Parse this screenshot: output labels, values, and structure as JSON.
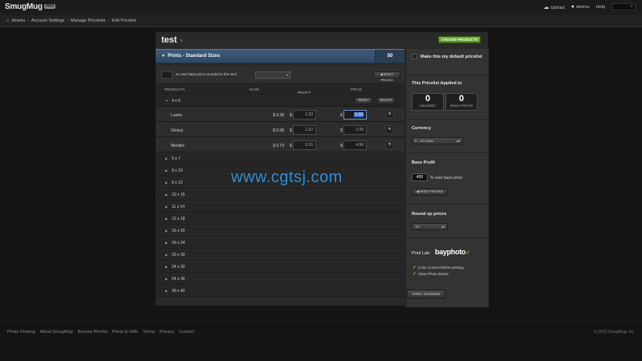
{
  "app": {
    "logo": "SmugMug",
    "logo_badge": "PRO"
  },
  "topbar": {
    "upload": "Upload",
    "user": "dmenu",
    "help": "Help",
    "search_icon": "search-icon"
  },
  "breadcrumb": [
    "dmenu",
    "Account Settings",
    "Manage Pricelists",
    "Edit Pricelist"
  ],
  "pricelist": {
    "title": "test",
    "choose_products": "CHOOSE PRODUCTS",
    "section_label": "Prints - Standard Sizes",
    "section_count": "50",
    "option_label": "% over base price rounded to the next",
    "option_select": "",
    "reset_pricing": "RESET PRICING",
    "columns": {
      "products": "PRODUCTS",
      "base": "BASE",
      "profit": "PROFIT",
      "price": "PRICE"
    },
    "group": {
      "name": "4 x 6",
      "reset": "RESET",
      "delete": "DELETE"
    },
    "items": [
      {
        "name": "Lustre",
        "base": "$ 0.38",
        "cur1": "$",
        "profit": "1.03",
        "cur2": "$",
        "price": "5.00"
      },
      {
        "name": "Glossy",
        "base": "$ 0.38",
        "cur1": "$",
        "profit": "1.52",
        "cur2": "$",
        "price": "2.99"
      },
      {
        "name": "Metallic",
        "base": "$ 0.79",
        "cur1": "$",
        "profit": "3.16",
        "cur2": "$",
        "price": "4.99"
      }
    ],
    "sizes": [
      "5 x 7",
      "8 x 10",
      "8 x 12",
      "10 x 15",
      "11 x 14",
      "12 x 18",
      "16 x 20",
      "16 x 24",
      "20 x 30",
      "24 x 30",
      "24 x 36",
      "30 x 40"
    ]
  },
  "sidebar": {
    "default_label": "Make this my default pricelist",
    "applied_to": "This Pricelist Applied to",
    "galleries_count": "0",
    "galleries_label": "GALLERIES",
    "single_photos_count": "0",
    "single_photos_label": "SINGLE PHOTOS",
    "currency_label": "Currency",
    "currency_value": "$ - US Dollar",
    "base_profit_label": "Base Profit",
    "base_profit_value": "400",
    "base_profit_suffix": "% over base price",
    "reset_pricing": "RESET PRICING",
    "round_up_label": "Round up prices",
    "round_up_value": ".99",
    "print_lab_label": "Print Lab",
    "print_lab_brand": "bayphoto",
    "opt1": "Color Correct before printing",
    "opt2": "Allow Photo Extras",
    "apply": "APPLY CHANGES"
  },
  "watermark": "www.cgtsj.com",
  "footer": {
    "links": [
      "Photo Sharing",
      "About SmugMug",
      "Browse Photos",
      "Prints & Gifts",
      "Terms",
      "Privacy",
      "Contact"
    ],
    "copyright": "© 2013 SmugMug, Inc"
  }
}
